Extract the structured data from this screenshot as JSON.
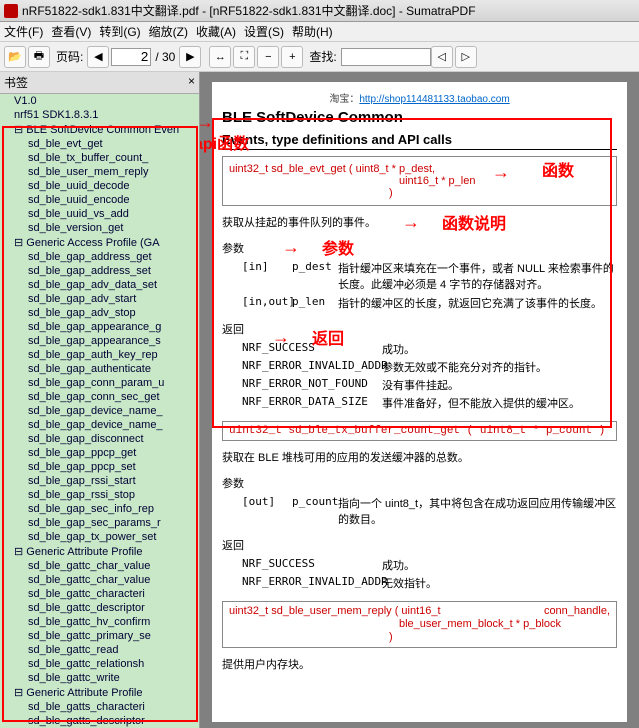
{
  "title": "nRF51822-sdk1.831中文翻译.pdf - [nRF51822-sdk1.831中文翻译.doc] - SumatraPDF",
  "menu": [
    "文件(F)",
    "查看(V)",
    "转到(G)",
    "缩放(Z)",
    "收藏(A)",
    "设置(S)",
    "帮助(H)"
  ],
  "toolbar": {
    "page_label": "页码:",
    "page_cur": "2",
    "page_total": "/ 30",
    "find_label": "查找:"
  },
  "sidebar": {
    "title": "书签",
    "nodes": [
      {
        "t": "V1.0",
        "lv": 0,
        "e": ""
      },
      {
        "t": "nrf51 SDK1.8.3.1",
        "lv": 0,
        "e": ""
      },
      {
        "t": "BLE SoftDevice Common Even",
        "lv": 0,
        "e": "exp"
      },
      {
        "t": "sd_ble_evt_get",
        "lv": 2
      },
      {
        "t": "sd_ble_tx_buffer_count_",
        "lv": 2
      },
      {
        "t": "sd_ble_user_mem_reply",
        "lv": 2
      },
      {
        "t": "sd_ble_uuid_decode",
        "lv": 2
      },
      {
        "t": "sd_ble_uuid_encode",
        "lv": 2
      },
      {
        "t": "sd_ble_uuid_vs_add",
        "lv": 2
      },
      {
        "t": "sd_ble_version_get",
        "lv": 2
      },
      {
        "t": "Generic Access Profile (GA",
        "lv": 0,
        "e": "exp"
      },
      {
        "t": "sd_ble_gap_address_get",
        "lv": 2
      },
      {
        "t": "sd_ble_gap_address_set",
        "lv": 2
      },
      {
        "t": "sd_ble_gap_adv_data_set",
        "lv": 2
      },
      {
        "t": "sd_ble_gap_adv_start",
        "lv": 2
      },
      {
        "t": "sd_ble_gap_adv_stop",
        "lv": 2
      },
      {
        "t": "sd_ble_gap_appearance_g",
        "lv": 2
      },
      {
        "t": "sd_ble_gap_appearance_s",
        "lv": 2
      },
      {
        "t": "sd_ble_gap_auth_key_rep",
        "lv": 2
      },
      {
        "t": "sd_ble_gap_authenticate",
        "lv": 2
      },
      {
        "t": "sd_ble_gap_conn_param_u",
        "lv": 2
      },
      {
        "t": "sd_ble_gap_conn_sec_get",
        "lv": 2
      },
      {
        "t": "sd_ble_gap_device_name_",
        "lv": 2
      },
      {
        "t": "sd_ble_gap_device_name_",
        "lv": 2
      },
      {
        "t": "sd_ble_gap_disconnect",
        "lv": 2
      },
      {
        "t": "sd_ble_gap_ppcp_get",
        "lv": 2
      },
      {
        "t": "sd_ble_gap_ppcp_set",
        "lv": 2
      },
      {
        "t": "sd_ble_gap_rssi_start",
        "lv": 2
      },
      {
        "t": "sd_ble_gap_rssi_stop",
        "lv": 2
      },
      {
        "t": "sd_ble_gap_sec_info_rep",
        "lv": 2
      },
      {
        "t": "sd_ble_gap_sec_params_r",
        "lv": 2
      },
      {
        "t": "sd_ble_gap_tx_power_set",
        "lv": 2
      },
      {
        "t": "Generic Attribute Profile",
        "lv": 0,
        "e": "exp"
      },
      {
        "t": "sd_ble_gattc_char_value",
        "lv": 2
      },
      {
        "t": "sd_ble_gattc_char_value",
        "lv": 2
      },
      {
        "t": "sd_ble_gattc_characteri",
        "lv": 2
      },
      {
        "t": "sd_ble_gattc_descriptor",
        "lv": 2
      },
      {
        "t": "sd_ble_gattc_hv_confirm",
        "lv": 2
      },
      {
        "t": "sd_ble_gattc_primary_se",
        "lv": 2
      },
      {
        "t": "sd_ble_gattc_read",
        "lv": 2
      },
      {
        "t": "sd_ble_gattc_relationsh",
        "lv": 2
      },
      {
        "t": "sd_ble_gattc_write",
        "lv": 2
      },
      {
        "t": "Generic Attribute Profile",
        "lv": 0,
        "e": "exp"
      },
      {
        "t": "sd_ble_gatts_characteri",
        "lv": 2
      },
      {
        "t": "sd_ble_gatts_descriptor",
        "lv": 2
      }
    ]
  },
  "doc": {
    "tao_label": "淘宝：",
    "tao_url": "http://shop114481133.taobao.com",
    "h1": "BLE SoftDevice Common",
    "h2": "Events, type definitions and API calls",
    "sig1a": "uint32_t sd_ble_evt_get ( uint8_t *   p_dest,",
    "sig1b": "uint16_t * p_len",
    "sig1c": ")",
    "desc1": "获取从挂起的事件队列的事件。",
    "params_label": "参数",
    "p1_dir": "[in]",
    "p1_name": "p_dest",
    "p1_desc": "指针缓冲区来填充在一个事件，或者 NULL 来检索事件的长度。此缓冲必须是 4 字节的存储器对齐。",
    "p2_dir": "[in,out]",
    "p2_name": "p_len",
    "p2_desc": "指针的缓冲区的长度，就返回它充满了该事件的长度。",
    "return_label": "返回",
    "r1_code": "NRF_SUCCESS",
    "r1_desc": "成功。",
    "r2_code": "NRF_ERROR_INVALID_ADDR",
    "r2_desc": "参数无效或不能充分对齐的指针。",
    "r3_code": "NRF_ERROR_NOT_FOUND",
    "r3_desc": "没有事件挂起。",
    "r4_code": "NRF_ERROR_DATA_SIZE",
    "r4_desc": "事件准备好，但不能放入提供的缓冲区。",
    "sig2": "uint32_t sd_ble_tx_buffer_count_get ( uint8_t * p_count )",
    "desc2": "获取在 BLE 堆栈可用的应用的发送缓冲器的总数。",
    "p3_dir": "[out]",
    "p3_name": "p_count",
    "p3_desc": "指向一个 uint8_t，其中将包含在成功返回应用传输缓冲区的数目。",
    "r5_code": "NRF_SUCCESS",
    "r5_desc": "成功。",
    "r6_code": "NRF_ERROR_INVALID_ADDR",
    "r6_desc": "无效指针。",
    "sig3a": "uint32_t sd_ble_user_mem_reply ( uint16_t",
    "sig3b": "conn_handle,",
    "sig3c": "ble_user_mem_block_t * p_block",
    "sig3d": ")",
    "desc3": "提供用户内存块。"
  },
  "anno": {
    "api": "api函数",
    "fn": "函数",
    "fndesc": "函数说明",
    "param": "参数",
    "ret": "返回"
  }
}
